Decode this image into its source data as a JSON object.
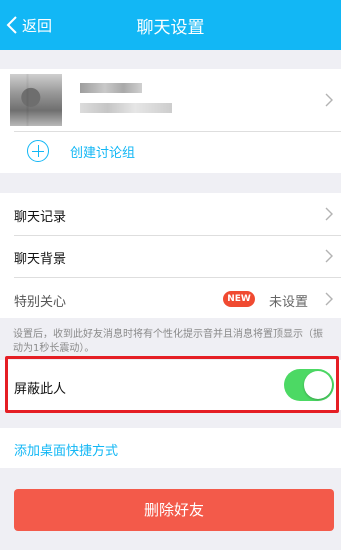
{
  "nav": {
    "back_label": "返回",
    "title": "聊天设置"
  },
  "profile": {
    "create_group_label": "创建讨论组"
  },
  "settings": {
    "chat_history": "聊天记录",
    "chat_background": "聊天背景",
    "special_care": "特别关心",
    "special_care_badge": "NEW",
    "special_care_status": "未设置"
  },
  "hint": "设置后，收到此好友消息时将有个性化提示音并且消息将置顶显示（振动为1秒长震动）。",
  "block": {
    "label": "屏蔽此人",
    "enabled": true
  },
  "shortcut_label": "添加桌面快捷方式",
  "delete_label": "删除好友",
  "colors": {
    "accent": "#12b7f5",
    "toggle_on": "#4cd964",
    "danger": "#f35a4a",
    "badge": "#f04a31",
    "highlight_box": "#e51e24"
  }
}
